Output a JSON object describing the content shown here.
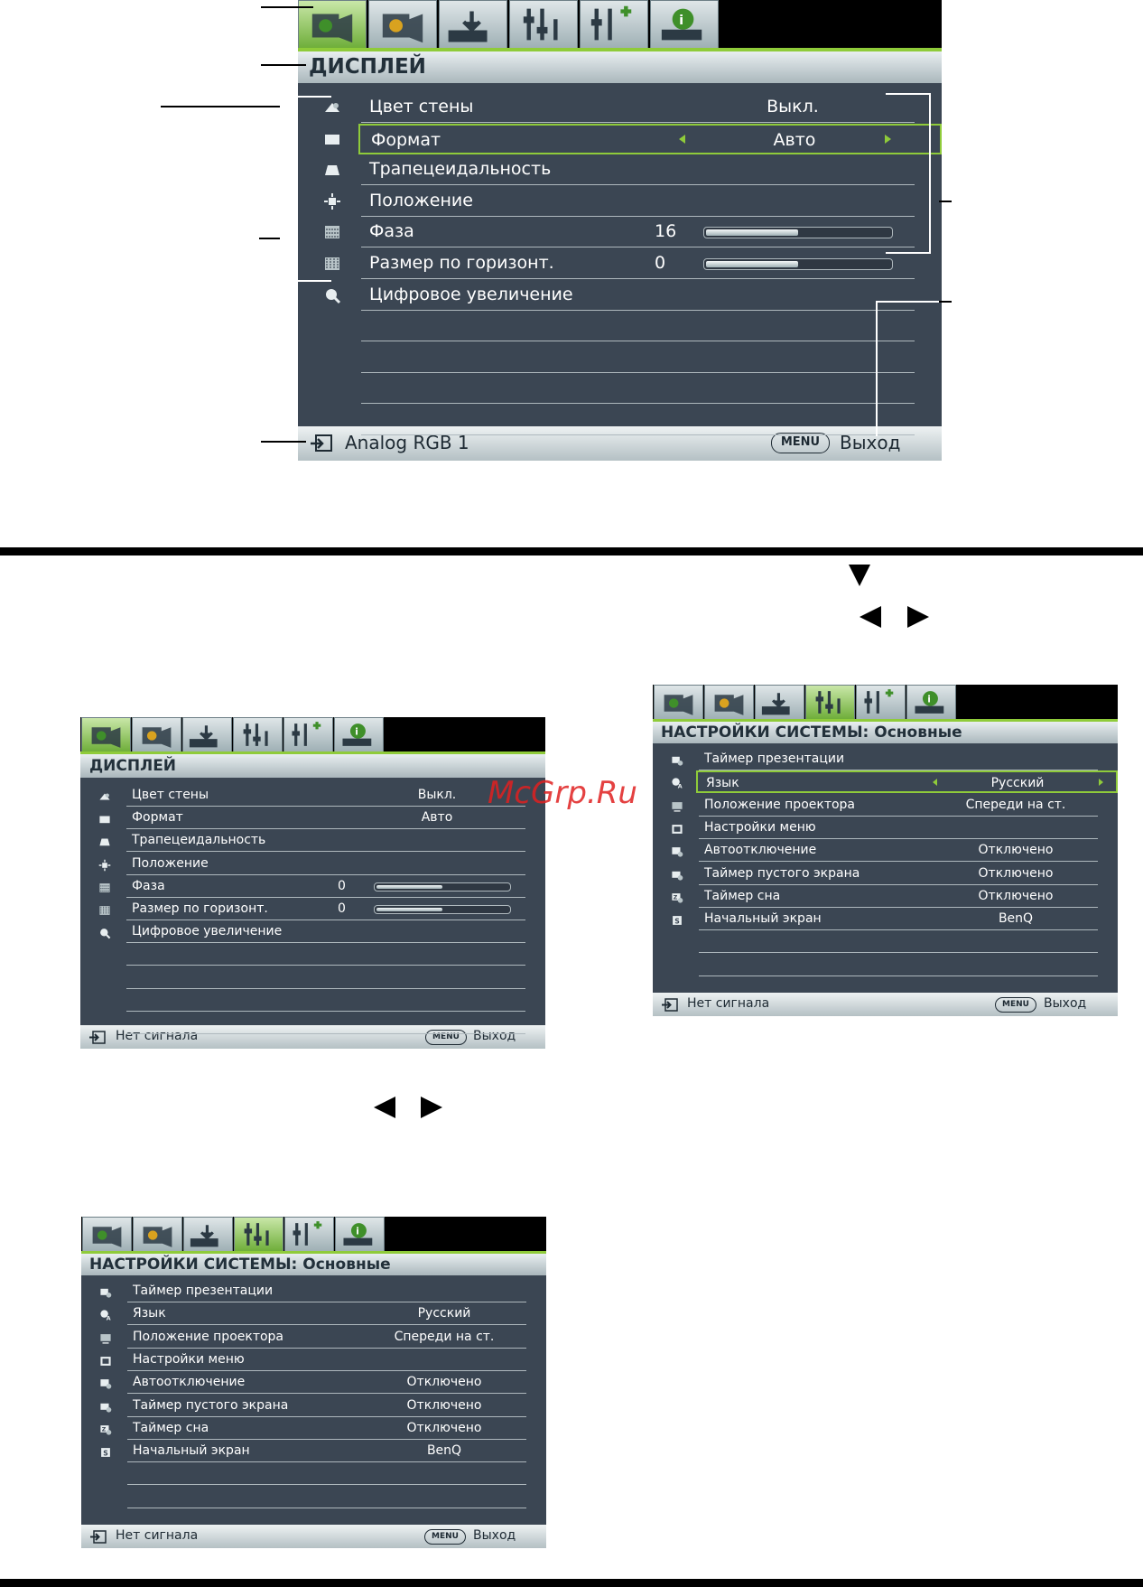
{
  "colors": {
    "panel": "#3b4653",
    "accent": "#8fcb3a",
    "titlebar": "#c8d2d6",
    "watermark": "#e02020"
  },
  "watermark": "McGrp.Ru",
  "tab_icons": [
    "display-tab-icon",
    "picture-tab-icon",
    "source-tab-icon",
    "system-basic-tab-icon",
    "system-advanced-tab-icon",
    "information-tab-icon"
  ],
  "osd_display_large": {
    "title": "ДИСПЛЕЙ",
    "rows": [
      {
        "label": "Цвет стены",
        "value": "Выкл.",
        "icon": "wall-color-icon"
      },
      {
        "label": "Формат",
        "value": "Авто",
        "icon": "aspect-ratio-icon",
        "selected": true
      },
      {
        "label": "Трапецеидальность",
        "icon": "keystone-icon"
      },
      {
        "label": "Положение",
        "icon": "position-icon"
      },
      {
        "label": "Фаза",
        "number": "16",
        "level": 0.5,
        "icon": "phase-icon"
      },
      {
        "label": "Размер по горизонт.",
        "number": "0",
        "level": 0.5,
        "icon": "h-size-icon"
      },
      {
        "label": "Цифровое увеличение",
        "icon": "digital-zoom-icon"
      }
    ],
    "footer": {
      "source": "Analog RGB 1",
      "menu_key": "MENU",
      "exit": "Выход"
    }
  },
  "osd_display_small": {
    "title": "ДИСПЛЕЙ",
    "rows": [
      {
        "label": "Цвет стены",
        "value": "Выкл.",
        "icon": "wall-color-icon"
      },
      {
        "label": "Формат",
        "value": "Авто",
        "icon": "aspect-ratio-icon"
      },
      {
        "label": "Трапецеидальность",
        "icon": "keystone-icon"
      },
      {
        "label": "Положение",
        "icon": "position-icon"
      },
      {
        "label": "Фаза",
        "number": "0",
        "level": 0.5,
        "icon": "phase-icon"
      },
      {
        "label": "Размер по горизонт.",
        "number": "0",
        "level": 0.5,
        "icon": "h-size-icon"
      },
      {
        "label": "Цифровое увеличение",
        "icon": "digital-zoom-icon"
      }
    ],
    "footer": {
      "source": "Нет сигнала",
      "menu_key": "MENU",
      "exit": "Выход"
    }
  },
  "osd_system_right": {
    "title": "НАСТРОЙКИ СИСТЕМЫ: Основные",
    "rows": [
      {
        "label": "Таймер презентации",
        "icon": "presentation-timer-icon"
      },
      {
        "label": "Язык",
        "value": "Русский",
        "icon": "language-icon",
        "selected": true
      },
      {
        "label": "Положение проектора",
        "value": "Спереди на ст.",
        "icon": "projector-position-icon"
      },
      {
        "label": "Настройки меню",
        "icon": "menu-settings-icon"
      },
      {
        "label": "Автоотключение",
        "value": "Отключено",
        "icon": "auto-off-icon"
      },
      {
        "label": "Таймер пустого экрана",
        "value": "Отключено",
        "icon": "blank-timer-icon"
      },
      {
        "label": "Таймер сна",
        "value": "Отключено",
        "icon": "sleep-timer-icon"
      },
      {
        "label": "Начальный экран",
        "value": "BenQ",
        "icon": "splash-screen-icon"
      }
    ],
    "footer": {
      "source": "Нет сигнала",
      "menu_key": "MENU",
      "exit": "Выход"
    }
  },
  "osd_system_bottom": {
    "title": "НАСТРОЙКИ СИСТЕМЫ: Основные",
    "rows": [
      {
        "label": "Таймер презентации",
        "icon": "presentation-timer-icon"
      },
      {
        "label": "Язык",
        "value": "Русский",
        "icon": "language-icon"
      },
      {
        "label": "Положение проектора",
        "value": "Спереди на ст.",
        "icon": "projector-position-icon"
      },
      {
        "label": "Настройки меню",
        "icon": "menu-settings-icon"
      },
      {
        "label": "Автоотключение",
        "value": "Отключено",
        "icon": "auto-off-icon"
      },
      {
        "label": "Таймер пустого экрана",
        "value": "Отключено",
        "icon": "blank-timer-icon"
      },
      {
        "label": "Таймер сна",
        "value": "Отключено",
        "icon": "sleep-timer-icon"
      },
      {
        "label": "Начальный экран",
        "value": "BenQ",
        "icon": "splash-screen-icon"
      }
    ],
    "footer": {
      "source": "Нет сигнала",
      "menu_key": "MENU",
      "exit": "Выход"
    }
  }
}
